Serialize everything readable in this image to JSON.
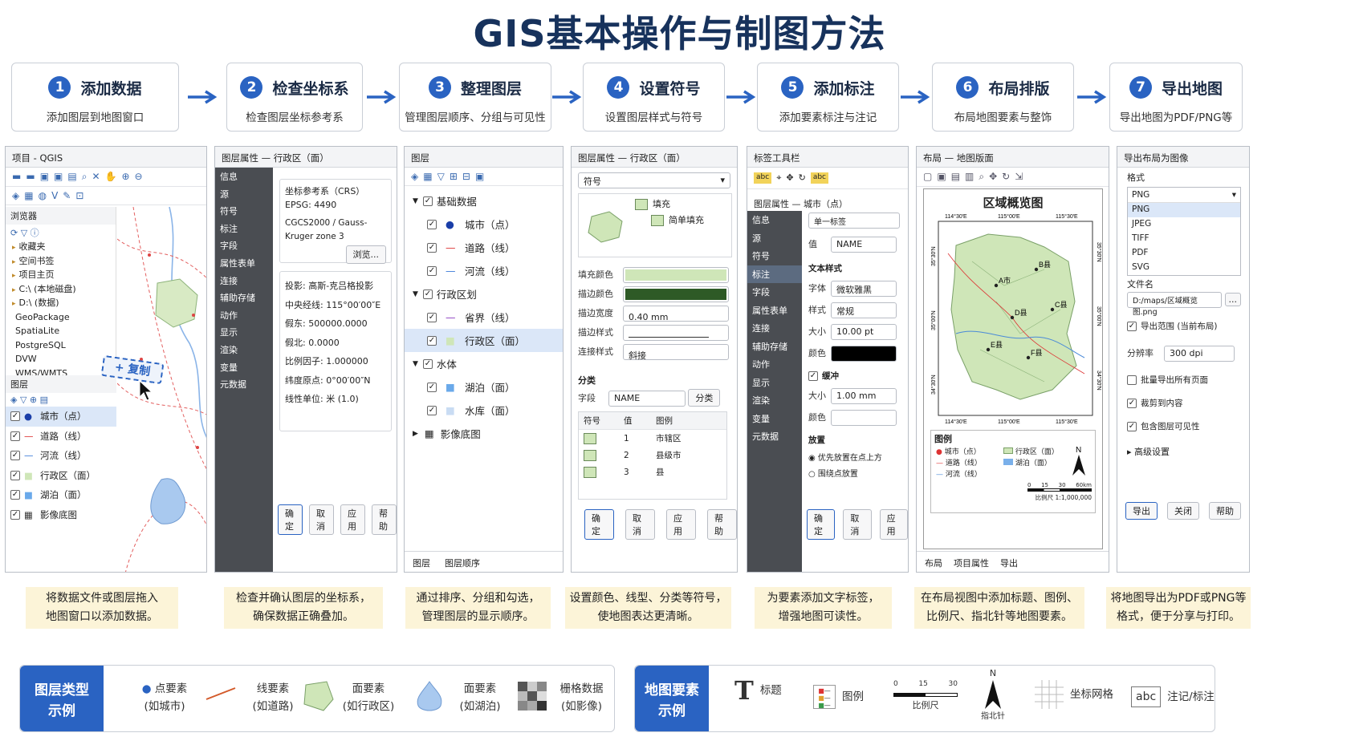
{
  "title": "GIS基本操作与制图方法",
  "steps": [
    {
      "num": "1",
      "title": "添加数据",
      "sub": "添加图层到地图窗口"
    },
    {
      "num": "2",
      "title": "检查坐标系",
      "sub": "检查图层坐标参考系"
    },
    {
      "num": "3",
      "title": "整理图层",
      "sub": "管理图层顺序、分组与可见性"
    },
    {
      "num": "4",
      "title": "设置符号",
      "sub": "设置图层样式与符号"
    },
    {
      "num": "5",
      "title": "添加标注",
      "sub": "添加要素标注与注记"
    },
    {
      "num": "6",
      "title": "布局排版",
      "sub": "布局地图要素与整饰"
    },
    {
      "num": "7",
      "title": "导出地图",
      "sub": "导出地图为PDF/PNG等"
    }
  ],
  "p1": {
    "title": "项目 - QGIS",
    "browser": "浏览器",
    "browser_items": [
      "收藏夹",
      "空间书签",
      "项目主页",
      "C:\\ (本地磁盘)",
      "D:\\ (数据)",
      "GeoPackage",
      "SpatiaLite",
      "PostgreSQL",
      "DVW",
      "WMS/WMTS"
    ],
    "layers_title": "图层",
    "layers": [
      "城市（点）",
      "道路（线）",
      "河流（线）",
      "行政区（面）",
      "湖泊（面）",
      "影像底图"
    ],
    "copy_label": "+ 复制"
  },
  "p2": {
    "title": "图层属性 — 行政区（面）",
    "tabs": [
      "信息",
      "源",
      "符号",
      "标注",
      "字段",
      "属性表单",
      "连接",
      "辅助存储",
      "动作",
      "显示",
      "渲染",
      "变量",
      "元数据"
    ],
    "crs_label": "坐标参考系（CRS）",
    "epsg": "EPSG: 4490",
    "crs_name": "CGCS2000 / Gauss-Kruger zone 3",
    "browse": "浏览...",
    "props": [
      "投影: 高斯-克吕格投影",
      "中央经线: 115°00′00″E",
      "假东: 500000.0000",
      "假北: 0.0000",
      "比例因子: 1.000000",
      "纬度原点: 0°00′00″N",
      "线性单位: 米 (1.0)"
    ],
    "buttons": [
      "确定",
      "取消",
      "应用",
      "帮助"
    ]
  },
  "p3": {
    "title": "图层",
    "group1": "基础数据",
    "g1_items": [
      "城市（点）",
      "道路（线）",
      "河流（线）"
    ],
    "group2": "行政区划",
    "g2_items": [
      "省界（线）",
      "行政区（面）"
    ],
    "group3": "水体",
    "g3_items": [
      "湖泊（面）",
      "水库（面）"
    ],
    "raster": "影像底图",
    "tabs": [
      "图层",
      "图层顺序"
    ]
  },
  "p4": {
    "title": "图层属性 — 行政区（面）",
    "symbol": "符号",
    "fill": "填充",
    "simple_fill": "简单填充",
    "fill_color_lbl": "填充颜色",
    "stroke_color_lbl": "描边颜色",
    "stroke_width_lbl": "描边宽度",
    "stroke_width": "0.40 mm",
    "stroke_style_lbl": "描边样式",
    "join_style_lbl": "连接样式",
    "join_style": "斜接",
    "classify": "分类",
    "field_lbl": "字段",
    "field": "NAME",
    "classify_btn": "分类",
    "cols": [
      "符号",
      "值",
      "图例"
    ],
    "rows": [
      [
        "1",
        "市辖区"
      ],
      [
        "2",
        "县级市"
      ],
      [
        "3",
        "县"
      ]
    ],
    "buttons": [
      "确定",
      "取消",
      "应用",
      "帮助"
    ],
    "fill_color": "#cfe6b8",
    "stroke_color": "#2e5a26"
  },
  "p5": {
    "title": "标签工具栏",
    "subtitle": "图层属性 — 城市（点）",
    "tabs": [
      "信息",
      "源",
      "符号",
      "标注",
      "字段",
      "属性表单",
      "连接",
      "辅助存储",
      "动作",
      "显示",
      "渲染",
      "变量",
      "元数据"
    ],
    "mode": "单一标签",
    "value_lbl": "值",
    "value": "NAME",
    "text_style": "文本样式",
    "font_lbl": "字体",
    "font": "微软雅黑",
    "style_lbl": "样式",
    "style": "常规",
    "size_lbl": "大小",
    "size": "10.00 pt",
    "color_lbl": "颜色",
    "buffer": "缓冲",
    "buf_size_lbl": "大小",
    "buf_size": "1.00 mm",
    "buf_color_lbl": "颜色",
    "placement": "放置",
    "opt1": "优先放置在点上方",
    "opt2": "围绕点放置",
    "buttons": [
      "确定",
      "取消",
      "应用"
    ]
  },
  "p6": {
    "title": "布局 — 地图版面",
    "map_title": "区域概览图",
    "lon": [
      "114°30′E",
      "115°00′E",
      "115°30′E"
    ],
    "lat": [
      "35°30′N",
      "35°00′N",
      "34°30′N"
    ],
    "towns": [
      "A市",
      "B县",
      "C县",
      "D县",
      "E县",
      "F县"
    ],
    "legend_title": "图例",
    "legend": [
      "城市（点）",
      "道路（线）",
      "河流（线）",
      "行政区（面）",
      "湖泊（面）"
    ],
    "scale_ticks": [
      "0",
      "15",
      "30",
      "60km"
    ],
    "scale_text": "比例尺 1:1,000,000",
    "north": "N",
    "tabs": [
      "布局",
      "项目属性",
      "导出"
    ]
  },
  "p7": {
    "title": "导出布局为图像",
    "format_lbl": "格式",
    "format": "PNG",
    "options": [
      "PNG",
      "JPEG",
      "TIFF",
      "PDF",
      "SVG"
    ],
    "file_lbl": "文件名",
    "file": "D:/maps/区域概览图.png",
    "file_btn": "...",
    "c1": "导出范围 (当前布局)",
    "dpi_lbl": "分辨率",
    "dpi": "300 dpi",
    "c2": "批量导出所有页面",
    "c3": "裁剪到内容",
    "c4": "包含图层可见性",
    "advanced": "高级设置",
    "buttons": [
      "导出",
      "关闭",
      "帮助"
    ]
  },
  "captions": [
    [
      "将数据文件或图层拖入",
      "地图窗口以添加数据。"
    ],
    [
      "检查并确认图层的坐标系，",
      "确保数据正确叠加。"
    ],
    [
      "通过排序、分组和勾选，",
      "管理图层的显示顺序。"
    ],
    [
      "设置颜色、线型、分类等符号，",
      "使地图表达更清晰。"
    ],
    [
      "为要素添加文字标签，",
      "增强地图可读性。"
    ],
    [
      "在布局视图中添加标题、图例、",
      "比例尺、指北针等地图要素。"
    ],
    [
      "将地图导出为PDF或PNG等",
      "格式，便于分享与打印。"
    ]
  ],
  "legend1": {
    "tag1": "图层类型",
    "tag2": "示例",
    "items": [
      [
        "点要素",
        "(如城市)"
      ],
      [
        "线要素",
        "(如道路)"
      ],
      [
        "面要素",
        "(如行政区)"
      ],
      [
        "面要素",
        "(如湖泊)"
      ],
      [
        "栅格数据",
        "(如影像)"
      ]
    ]
  },
  "legend2": {
    "tag1": "地图要素",
    "tag2": "示例",
    "title_lbl": "标题",
    "legend_lbl": "图例",
    "scale_lbl": "比例尺",
    "scale_ticks": [
      "0",
      "15",
      "30"
    ],
    "north_lbl": "指北针",
    "north": "N",
    "grid_lbl": "坐标网格",
    "abc": "abc",
    "annot_lbl": "注记/标注"
  },
  "colors": {
    "accent": "#2a63c2",
    "title": "#17325c",
    "caption_bg": "#fcf4d8"
  }
}
